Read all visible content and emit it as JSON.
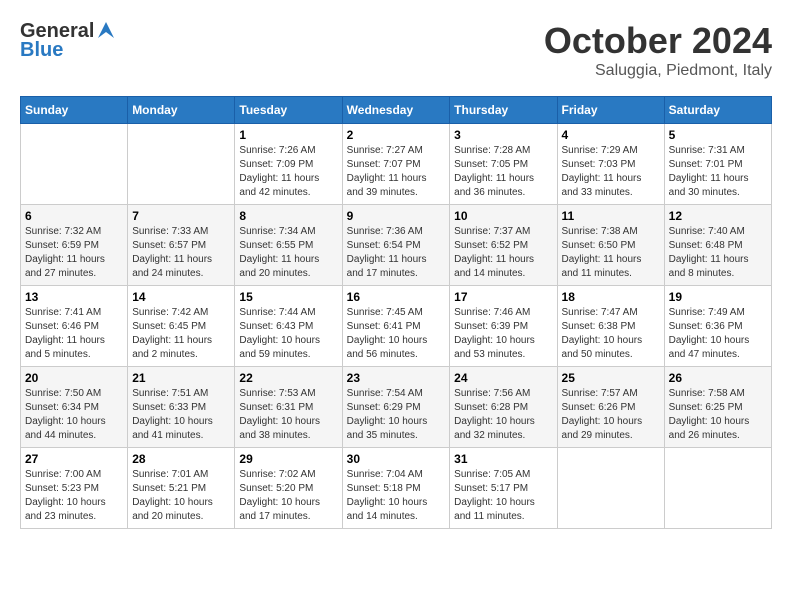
{
  "header": {
    "logo_line1": "General",
    "logo_line2": "Blue",
    "month": "October 2024",
    "location": "Saluggia, Piedmont, Italy"
  },
  "days_of_week": [
    "Sunday",
    "Monday",
    "Tuesday",
    "Wednesday",
    "Thursday",
    "Friday",
    "Saturday"
  ],
  "weeks": [
    [
      {
        "day": "",
        "sunrise": "",
        "sunset": "",
        "daylight": ""
      },
      {
        "day": "",
        "sunrise": "",
        "sunset": "",
        "daylight": ""
      },
      {
        "day": "1",
        "sunrise": "Sunrise: 7:26 AM",
        "sunset": "Sunset: 7:09 PM",
        "daylight": "Daylight: 11 hours and 42 minutes."
      },
      {
        "day": "2",
        "sunrise": "Sunrise: 7:27 AM",
        "sunset": "Sunset: 7:07 PM",
        "daylight": "Daylight: 11 hours and 39 minutes."
      },
      {
        "day": "3",
        "sunrise": "Sunrise: 7:28 AM",
        "sunset": "Sunset: 7:05 PM",
        "daylight": "Daylight: 11 hours and 36 minutes."
      },
      {
        "day": "4",
        "sunrise": "Sunrise: 7:29 AM",
        "sunset": "Sunset: 7:03 PM",
        "daylight": "Daylight: 11 hours and 33 minutes."
      },
      {
        "day": "5",
        "sunrise": "Sunrise: 7:31 AM",
        "sunset": "Sunset: 7:01 PM",
        "daylight": "Daylight: 11 hours and 30 minutes."
      }
    ],
    [
      {
        "day": "6",
        "sunrise": "Sunrise: 7:32 AM",
        "sunset": "Sunset: 6:59 PM",
        "daylight": "Daylight: 11 hours and 27 minutes."
      },
      {
        "day": "7",
        "sunrise": "Sunrise: 7:33 AM",
        "sunset": "Sunset: 6:57 PM",
        "daylight": "Daylight: 11 hours and 24 minutes."
      },
      {
        "day": "8",
        "sunrise": "Sunrise: 7:34 AM",
        "sunset": "Sunset: 6:55 PM",
        "daylight": "Daylight: 11 hours and 20 minutes."
      },
      {
        "day": "9",
        "sunrise": "Sunrise: 7:36 AM",
        "sunset": "Sunset: 6:54 PM",
        "daylight": "Daylight: 11 hours and 17 minutes."
      },
      {
        "day": "10",
        "sunrise": "Sunrise: 7:37 AM",
        "sunset": "Sunset: 6:52 PM",
        "daylight": "Daylight: 11 hours and 14 minutes."
      },
      {
        "day": "11",
        "sunrise": "Sunrise: 7:38 AM",
        "sunset": "Sunset: 6:50 PM",
        "daylight": "Daylight: 11 hours and 11 minutes."
      },
      {
        "day": "12",
        "sunrise": "Sunrise: 7:40 AM",
        "sunset": "Sunset: 6:48 PM",
        "daylight": "Daylight: 11 hours and 8 minutes."
      }
    ],
    [
      {
        "day": "13",
        "sunrise": "Sunrise: 7:41 AM",
        "sunset": "Sunset: 6:46 PM",
        "daylight": "Daylight: 11 hours and 5 minutes."
      },
      {
        "day": "14",
        "sunrise": "Sunrise: 7:42 AM",
        "sunset": "Sunset: 6:45 PM",
        "daylight": "Daylight: 11 hours and 2 minutes."
      },
      {
        "day": "15",
        "sunrise": "Sunrise: 7:44 AM",
        "sunset": "Sunset: 6:43 PM",
        "daylight": "Daylight: 10 hours and 59 minutes."
      },
      {
        "day": "16",
        "sunrise": "Sunrise: 7:45 AM",
        "sunset": "Sunset: 6:41 PM",
        "daylight": "Daylight: 10 hours and 56 minutes."
      },
      {
        "day": "17",
        "sunrise": "Sunrise: 7:46 AM",
        "sunset": "Sunset: 6:39 PM",
        "daylight": "Daylight: 10 hours and 53 minutes."
      },
      {
        "day": "18",
        "sunrise": "Sunrise: 7:47 AM",
        "sunset": "Sunset: 6:38 PM",
        "daylight": "Daylight: 10 hours and 50 minutes."
      },
      {
        "day": "19",
        "sunrise": "Sunrise: 7:49 AM",
        "sunset": "Sunset: 6:36 PM",
        "daylight": "Daylight: 10 hours and 47 minutes."
      }
    ],
    [
      {
        "day": "20",
        "sunrise": "Sunrise: 7:50 AM",
        "sunset": "Sunset: 6:34 PM",
        "daylight": "Daylight: 10 hours and 44 minutes."
      },
      {
        "day": "21",
        "sunrise": "Sunrise: 7:51 AM",
        "sunset": "Sunset: 6:33 PM",
        "daylight": "Daylight: 10 hours and 41 minutes."
      },
      {
        "day": "22",
        "sunrise": "Sunrise: 7:53 AM",
        "sunset": "Sunset: 6:31 PM",
        "daylight": "Daylight: 10 hours and 38 minutes."
      },
      {
        "day": "23",
        "sunrise": "Sunrise: 7:54 AM",
        "sunset": "Sunset: 6:29 PM",
        "daylight": "Daylight: 10 hours and 35 minutes."
      },
      {
        "day": "24",
        "sunrise": "Sunrise: 7:56 AM",
        "sunset": "Sunset: 6:28 PM",
        "daylight": "Daylight: 10 hours and 32 minutes."
      },
      {
        "day": "25",
        "sunrise": "Sunrise: 7:57 AM",
        "sunset": "Sunset: 6:26 PM",
        "daylight": "Daylight: 10 hours and 29 minutes."
      },
      {
        "day": "26",
        "sunrise": "Sunrise: 7:58 AM",
        "sunset": "Sunset: 6:25 PM",
        "daylight": "Daylight: 10 hours and 26 minutes."
      }
    ],
    [
      {
        "day": "27",
        "sunrise": "Sunrise: 7:00 AM",
        "sunset": "Sunset: 5:23 PM",
        "daylight": "Daylight: 10 hours and 23 minutes."
      },
      {
        "day": "28",
        "sunrise": "Sunrise: 7:01 AM",
        "sunset": "Sunset: 5:21 PM",
        "daylight": "Daylight: 10 hours and 20 minutes."
      },
      {
        "day": "29",
        "sunrise": "Sunrise: 7:02 AM",
        "sunset": "Sunset: 5:20 PM",
        "daylight": "Daylight: 10 hours and 17 minutes."
      },
      {
        "day": "30",
        "sunrise": "Sunrise: 7:04 AM",
        "sunset": "Sunset: 5:18 PM",
        "daylight": "Daylight: 10 hours and 14 minutes."
      },
      {
        "day": "31",
        "sunrise": "Sunrise: 7:05 AM",
        "sunset": "Sunset: 5:17 PM",
        "daylight": "Daylight: 10 hours and 11 minutes."
      },
      {
        "day": "",
        "sunrise": "",
        "sunset": "",
        "daylight": ""
      },
      {
        "day": "",
        "sunrise": "",
        "sunset": "",
        "daylight": ""
      }
    ]
  ]
}
